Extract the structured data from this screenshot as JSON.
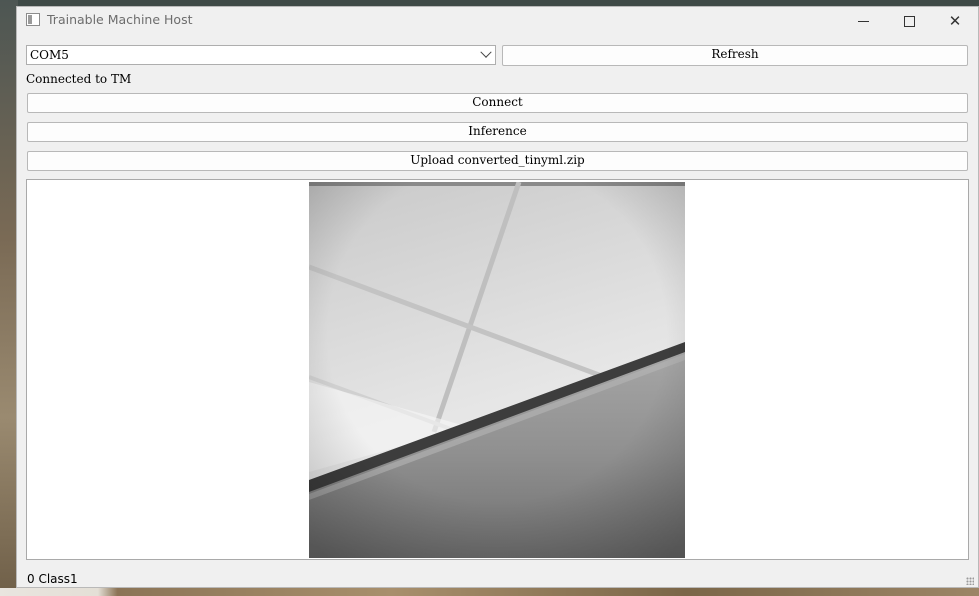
{
  "window": {
    "title": "Trainable Machine Host",
    "controls": {
      "minimize": "minimize-icon",
      "maximize": "maximize-icon",
      "close": "close-icon"
    }
  },
  "serial": {
    "port_selected": "COM5",
    "refresh_label": "Refresh",
    "status_text": "Connected to TM"
  },
  "actions": {
    "connect_label": "Connect",
    "inference_label": "Inference",
    "upload_label": "Upload converted_tinyml.zip"
  },
  "result": {
    "prediction_text": "0 Class1"
  },
  "colors": {
    "window_bg": "#f0f0f0",
    "view_bg": "#ffffff",
    "button_bg": "#fdfdfd"
  }
}
